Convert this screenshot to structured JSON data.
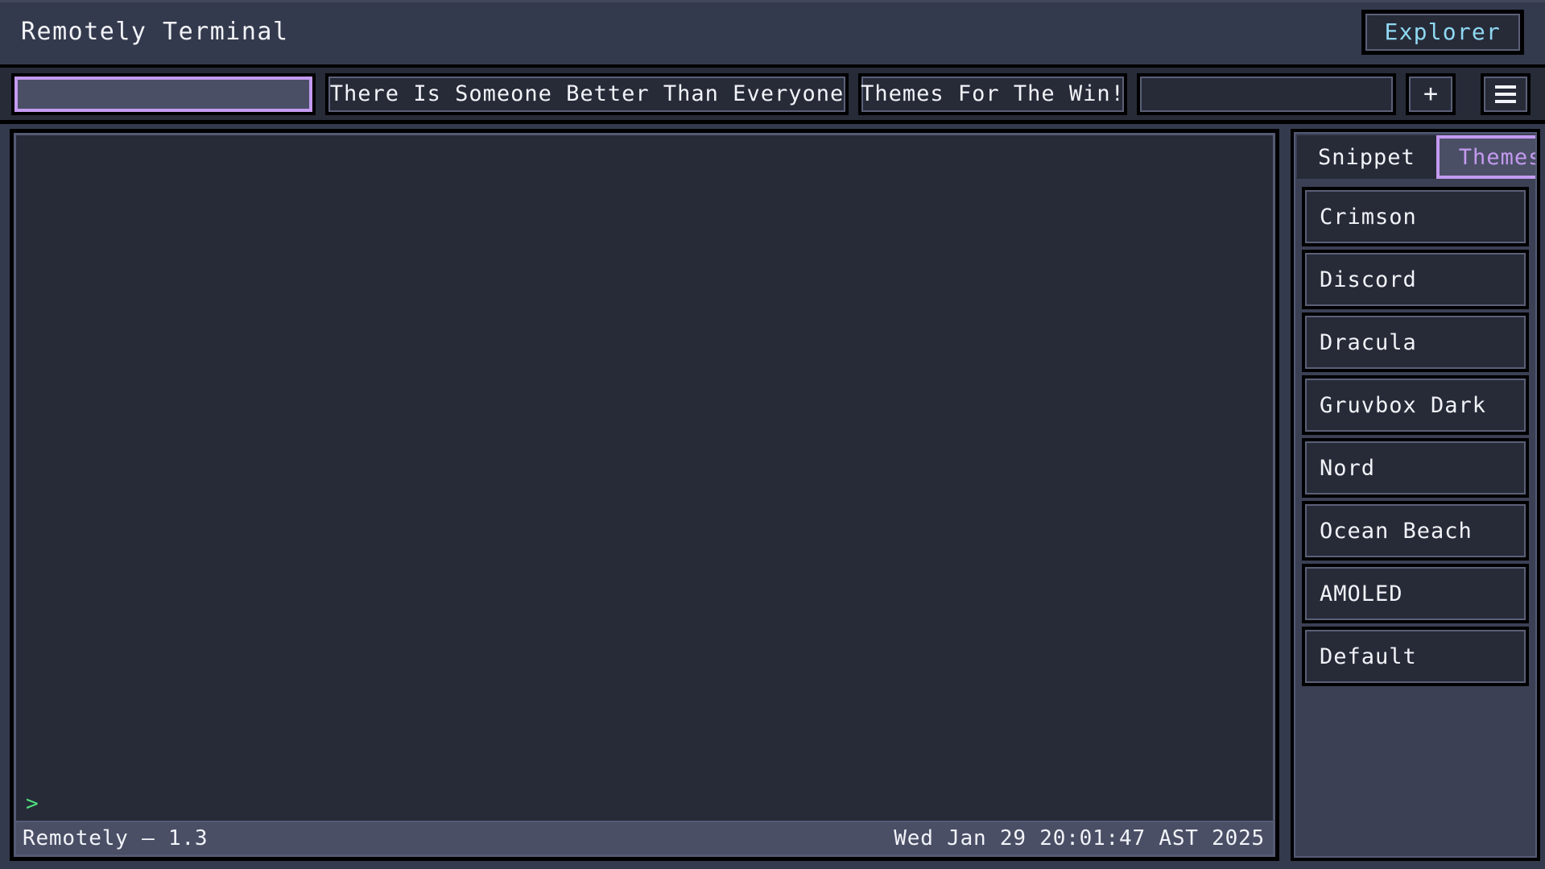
{
  "window": {
    "title": "Remotely Terminal",
    "explorer_button": "Explorer"
  },
  "colors": {
    "accent_purple": "#c49af0",
    "accent_cyan": "#8fd8f2",
    "prompt_green": "#4ee07e",
    "panel_bg": "#272b38",
    "chrome_bg": "#343a4d",
    "sidebar_bg": "#3b4055",
    "statusbar_bg": "#4a4f66",
    "border_black": "#000000",
    "border_gray": "#5b6078",
    "text_primary": "#f2f3f8"
  },
  "tabbar": {
    "tabs": [
      {
        "label": "",
        "active": true
      },
      {
        "label": "There Is Someone Better Than Everyone",
        "active": false
      },
      {
        "label": "Themes For The Win!",
        "active": false
      },
      {
        "label": "",
        "active": false
      }
    ],
    "add_tab_label": "+",
    "add_tab_icon": "plus-icon",
    "menu_icon": "hamburger-menu-icon"
  },
  "terminal": {
    "output": "",
    "prompt_symbol": ">",
    "prompt_input": ""
  },
  "statusbar": {
    "left": "Remotely — 1.3",
    "right": "Wed Jan 29 20:01:47 AST 2025"
  },
  "sidebar": {
    "tabs": [
      {
        "label": "Snippet",
        "active": false
      },
      {
        "label": "Themes",
        "active": true
      }
    ],
    "themes": [
      {
        "label": "Crimson"
      },
      {
        "label": "Discord"
      },
      {
        "label": "Dracula"
      },
      {
        "label": "Gruvbox Dark"
      },
      {
        "label": "Nord"
      },
      {
        "label": "Ocean Beach"
      },
      {
        "label": "AMOLED"
      },
      {
        "label": "Default"
      }
    ]
  }
}
